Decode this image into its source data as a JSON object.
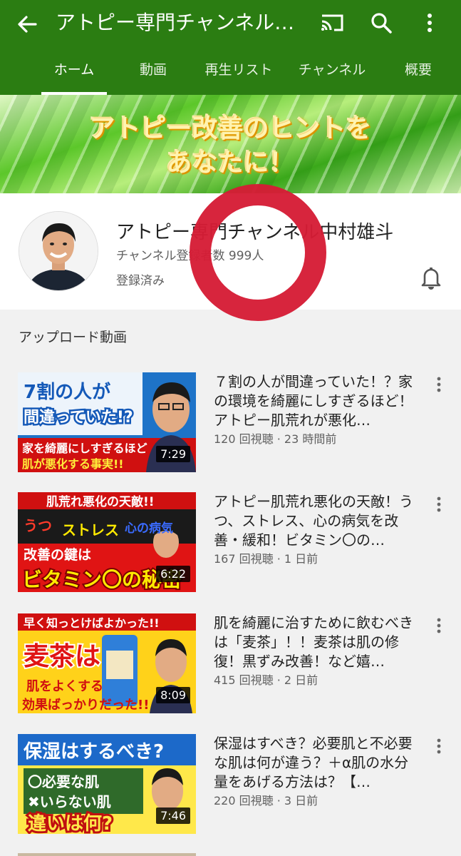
{
  "appbar": {
    "title": "アトピー専門チャンネル中村雄斗",
    "tabs": [
      "ホーム",
      "動画",
      "再生リスト",
      "チャンネル",
      "概要"
    ]
  },
  "banner": {
    "line1": "アトピー改善のヒントを",
    "line2": "あなたに！"
  },
  "channel": {
    "name": "アトピー専門チャンネル中村雄斗",
    "subscribers": "チャンネル登録者数 999人",
    "status": "登録済み"
  },
  "uploads": {
    "heading": "アップロード動画",
    "videos": [
      {
        "title": "７割の人が間違っていた！？家の環境を綺麗にしすぎるほど！アトピー肌荒れが悪化…",
        "meta": "120 回視聴 · 23 時間前",
        "duration": "7:29",
        "thumb_lines": [
          "7割の人が",
          "間違っていた!?",
          "家を綺麗にしすぎるほど",
          "肌が悪化する事実!!"
        ]
      },
      {
        "title": "アトピー肌荒れ悪化の天敵！うつ、ストレス、心の病気を改善・緩和！ビタミン〇の…",
        "meta": "167 回視聴 · 1 日前",
        "duration": "6:22",
        "thumb_lines": [
          "肌荒れ悪化の天敵!!",
          "うつ",
          "ストレス",
          "心の病気",
          "改善の鍵は",
          "ビタミン〇の秘密"
        ]
      },
      {
        "title": "肌を綺麗に治すために飲むべきは「麦茶」！！麦茶は肌の修復！黒ずみ改善！など嬉…",
        "meta": "415 回視聴 · 2 日前",
        "duration": "8:09",
        "thumb_lines": [
          "早く知っとけばよかった!!",
          "麦茶は",
          "肌をよくする",
          "効果ばっかりだった!!"
        ]
      },
      {
        "title": "保湿はすべき？必要肌と不必要な肌は何が違う？＋α肌の水分量をあげる方法は？【…",
        "meta": "220 回視聴 · 3 日前",
        "duration": "7:46",
        "thumb_lines": [
          "保湿はするべき?",
          "〇必要な肌",
          "✖いらない肌",
          "違いは何?"
        ]
      }
    ]
  }
}
